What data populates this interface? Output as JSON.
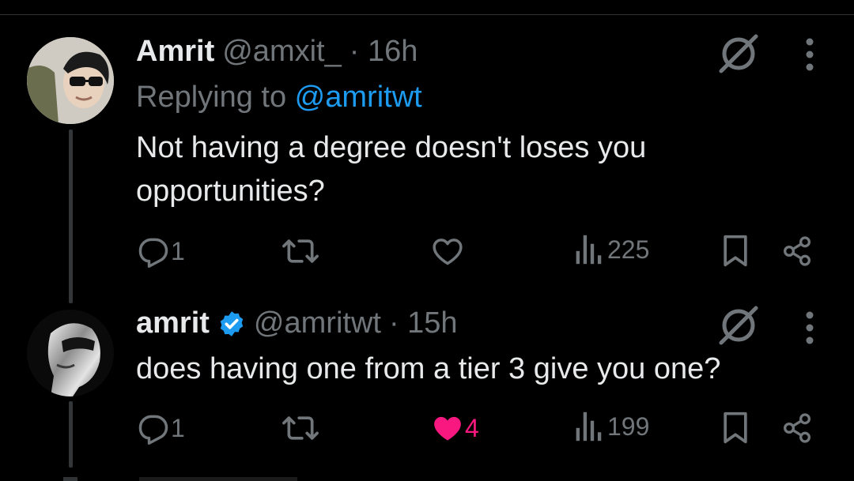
{
  "tweets": [
    {
      "name": "Amrit",
      "handle": "@amxit_",
      "time": "· 16h",
      "replying_prefix": "Replying to ",
      "replying_to": "@amritwt",
      "text": "Not having a degree doesn't loses you opportunities?",
      "replies": "1",
      "retweets": "",
      "likes": "",
      "views": "225"
    },
    {
      "name": "amrit",
      "handle": "@amritwt",
      "time": "· 15h",
      "verified": true,
      "text": "does having one from a tier 3 give you one?",
      "replies": "1",
      "retweets": "",
      "likes": "4",
      "views": "199",
      "liked": true
    }
  ],
  "colors": {
    "background": "#000000",
    "text": "#e7e9ea",
    "muted": "#71767b",
    "link": "#1d9bf0",
    "like": "#f91880"
  },
  "icons": [
    "grok-icon",
    "more-icon",
    "reply-icon",
    "retweet-icon",
    "like-icon",
    "views-icon",
    "bookmark-icon",
    "share-icon",
    "verified-badge-icon"
  ]
}
